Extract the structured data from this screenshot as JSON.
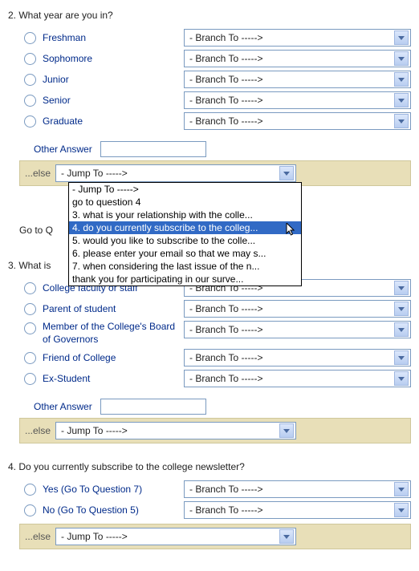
{
  "branch_default": "- Branch To ----->",
  "jump_default": "- Jump To ----->",
  "else_label": "...else",
  "other_label": "Other Answer",
  "goto_placeholder": "Go to Q",
  "q2": {
    "title": "2. What year are you in?",
    "options": [
      "Freshman",
      "Sophomore",
      "Junior",
      "Senior",
      "Graduate"
    ]
  },
  "dropdown_items": [
    "- Jump To ----->",
    "go to question 4",
    "3. what is your relationship with the colle...",
    "4. do you currently subscribe to the colleg...",
    "5. would you like to subscribe to the colle...",
    "6. please enter your email so that we may s...",
    "7. when considering the last issue of the n...",
    "thank you for participating in our surve..."
  ],
  "dropdown_highlight_index": 3,
  "q3": {
    "title": "3. What is",
    "options": [
      "College faculty or staff",
      "Parent of student",
      "Member of the College's Board of Governors",
      "Friend of College",
      "Ex-Student"
    ]
  },
  "q4": {
    "title": "4. Do you currently subscribe to the college newsletter?",
    "options": [
      "Yes (Go To Question 7)",
      "No (Go To Question 5)"
    ]
  }
}
